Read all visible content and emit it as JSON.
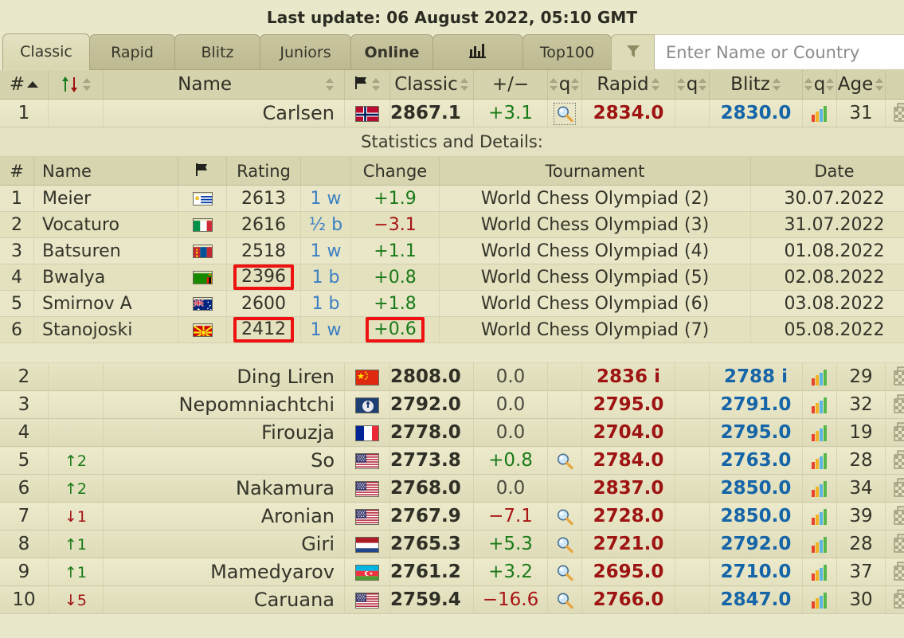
{
  "header": {
    "last_update": "Last update: 06 August 2022, 05:10 GMT"
  },
  "tabs": {
    "classic": "Classic",
    "rapid": "Rapid",
    "blitz": "Blitz",
    "juniors": "Juniors",
    "online": "Online",
    "chart_icon": "bar-chart-icon",
    "top100": "Top100",
    "filter_icon": "funnel-filter-icon"
  },
  "search": {
    "placeholder": "Enter Name or Country",
    "value": ""
  },
  "main_table": {
    "headers": {
      "rank": "#",
      "move": "",
      "name": "Name",
      "flag": "flag-icon",
      "classic": "Classic",
      "pm": "+/−",
      "mag": "q",
      "rapid": "Rapid",
      "mag2": "q",
      "blitz": "Blitz",
      "mag3": "q",
      "age": "Age"
    },
    "rows": [
      {
        "rank": "1",
        "move": "",
        "move_dir": "",
        "name": "Carlsen",
        "flag": "no",
        "classic": "2867.1",
        "pm": "+3.1",
        "pm_sign": "pos",
        "mag": true,
        "mag_focus": true,
        "rapid": "2834.0",
        "blitz": "2830.0",
        "graph": true,
        "age": "31",
        "board": true
      },
      {
        "rank": "2",
        "move": "",
        "move_dir": "",
        "name": "Ding Liren",
        "flag": "cn",
        "classic": "2808.0",
        "pm": "0.0",
        "pm_sign": "zero",
        "mag": false,
        "rapid": "2836 i",
        "blitz": "2788 i",
        "graph": true,
        "age": "29",
        "board": true
      },
      {
        "rank": "3",
        "move": "",
        "move_dir": "",
        "name": "Nepomniachtchi",
        "flag": "fide",
        "classic": "2792.0",
        "pm": "0.0",
        "pm_sign": "zero",
        "mag": false,
        "rapid": "2795.0",
        "blitz": "2791.0",
        "graph": true,
        "age": "32",
        "board": true
      },
      {
        "rank": "4",
        "move": "",
        "move_dir": "",
        "name": "Firouzja",
        "flag": "fr",
        "classic": "2778.0",
        "pm": "0.0",
        "pm_sign": "zero",
        "mag": false,
        "rapid": "2704.0",
        "blitz": "2795.0",
        "graph": true,
        "age": "19",
        "board": true
      },
      {
        "rank": "5",
        "move": "2",
        "move_dir": "up",
        "name": "So",
        "flag": "us",
        "classic": "2773.8",
        "pm": "+0.8",
        "pm_sign": "pos",
        "mag": true,
        "rapid": "2784.0",
        "blitz": "2763.0",
        "graph": true,
        "age": "28",
        "board": true
      },
      {
        "rank": "6",
        "move": "2",
        "move_dir": "up",
        "name": "Nakamura",
        "flag": "us",
        "classic": "2768.0",
        "pm": "0.0",
        "pm_sign": "zero",
        "mag": false,
        "rapid": "2837.0",
        "blitz": "2850.0",
        "graph": true,
        "age": "34",
        "board": true
      },
      {
        "rank": "7",
        "move": "1",
        "move_dir": "down",
        "name": "Aronian",
        "flag": "us",
        "classic": "2767.9",
        "pm": "−7.1",
        "pm_sign": "neg",
        "mag": true,
        "rapid": "2728.0",
        "blitz": "2850.0",
        "graph": true,
        "age": "39",
        "board": true
      },
      {
        "rank": "8",
        "move": "1",
        "move_dir": "up",
        "name": "Giri",
        "flag": "nl",
        "classic": "2765.3",
        "pm": "+5.3",
        "pm_sign": "pos",
        "mag": true,
        "rapid": "2721.0",
        "blitz": "2792.0",
        "graph": true,
        "age": "28",
        "board": true
      },
      {
        "rank": "9",
        "move": "1",
        "move_dir": "up",
        "name": "Mamedyarov",
        "flag": "az",
        "classic": "2761.2",
        "pm": "+3.2",
        "pm_sign": "pos",
        "mag": true,
        "rapid": "2695.0",
        "blitz": "2710.0",
        "graph": true,
        "age": "37",
        "board": true
      },
      {
        "rank": "10",
        "move": "5",
        "move_dir": "down",
        "name": "Caruana",
        "flag": "us",
        "classic": "2759.4",
        "pm": "−16.6",
        "pm_sign": "neg",
        "mag": true,
        "rapid": "2766.0",
        "blitz": "2847.0",
        "graph": true,
        "age": "30",
        "board": true
      }
    ]
  },
  "detail_panel": {
    "title": "Statistics and Details:",
    "headers": {
      "num": "#",
      "name": "Name",
      "flag": "flag-icon",
      "rating": "Rating",
      "result": "",
      "change": "Change",
      "tournament": "Tournament",
      "date": "Date"
    },
    "rows": [
      {
        "num": "1",
        "name": "Meier",
        "flag": "uy",
        "rating": "2613",
        "rating_hl": false,
        "result": "1 w",
        "change": "+1.9",
        "change_sign": "pos",
        "change_hl": false,
        "tournament": "World Chess Olympiad (2)",
        "date": "30.07.2022"
      },
      {
        "num": "2",
        "name": "Vocaturo",
        "flag": "it",
        "rating": "2616",
        "rating_hl": false,
        "result": "½ b",
        "change": "−3.1",
        "change_sign": "neg",
        "change_hl": false,
        "tournament": "World Chess Olympiad (3)",
        "date": "31.07.2022"
      },
      {
        "num": "3",
        "name": "Batsuren",
        "flag": "mn",
        "rating": "2518",
        "rating_hl": false,
        "result": "1 w",
        "change": "+1.1",
        "change_sign": "pos",
        "change_hl": false,
        "tournament": "World Chess Olympiad (4)",
        "date": "01.08.2022"
      },
      {
        "num": "4",
        "name": "Bwalya",
        "flag": "zm",
        "rating": "2396",
        "rating_hl": true,
        "result": "1 b",
        "change": "+0.8",
        "change_sign": "pos",
        "change_hl": false,
        "tournament": "World Chess Olympiad (5)",
        "date": "02.08.2022"
      },
      {
        "num": "5",
        "name": "Smirnov A",
        "flag": "au",
        "rating": "2600",
        "rating_hl": false,
        "result": "1 b",
        "change": "+1.8",
        "change_sign": "pos",
        "change_hl": false,
        "tournament": "World Chess Olympiad (6)",
        "date": "03.08.2022"
      },
      {
        "num": "6",
        "name": "Stanojoski",
        "flag": "mk",
        "rating": "2412",
        "rating_hl": true,
        "result": "1 w",
        "change": "+0.6",
        "change_sign": "pos",
        "change_hl": true,
        "tournament": "World Chess Olympiad (7)",
        "date": "05.08.2022"
      }
    ]
  },
  "colors": {
    "page_bg": "#e9e8ca",
    "tab_active": "#dedcb8",
    "tab_inactive": "#c3c098",
    "header_row": "#d5d3ad",
    "rapid_text": "#9e1412",
    "blitz_text": "#1565a8",
    "positive": "#1a7a1a",
    "negative": "#a81414",
    "highlight_box": "#ee1111"
  }
}
